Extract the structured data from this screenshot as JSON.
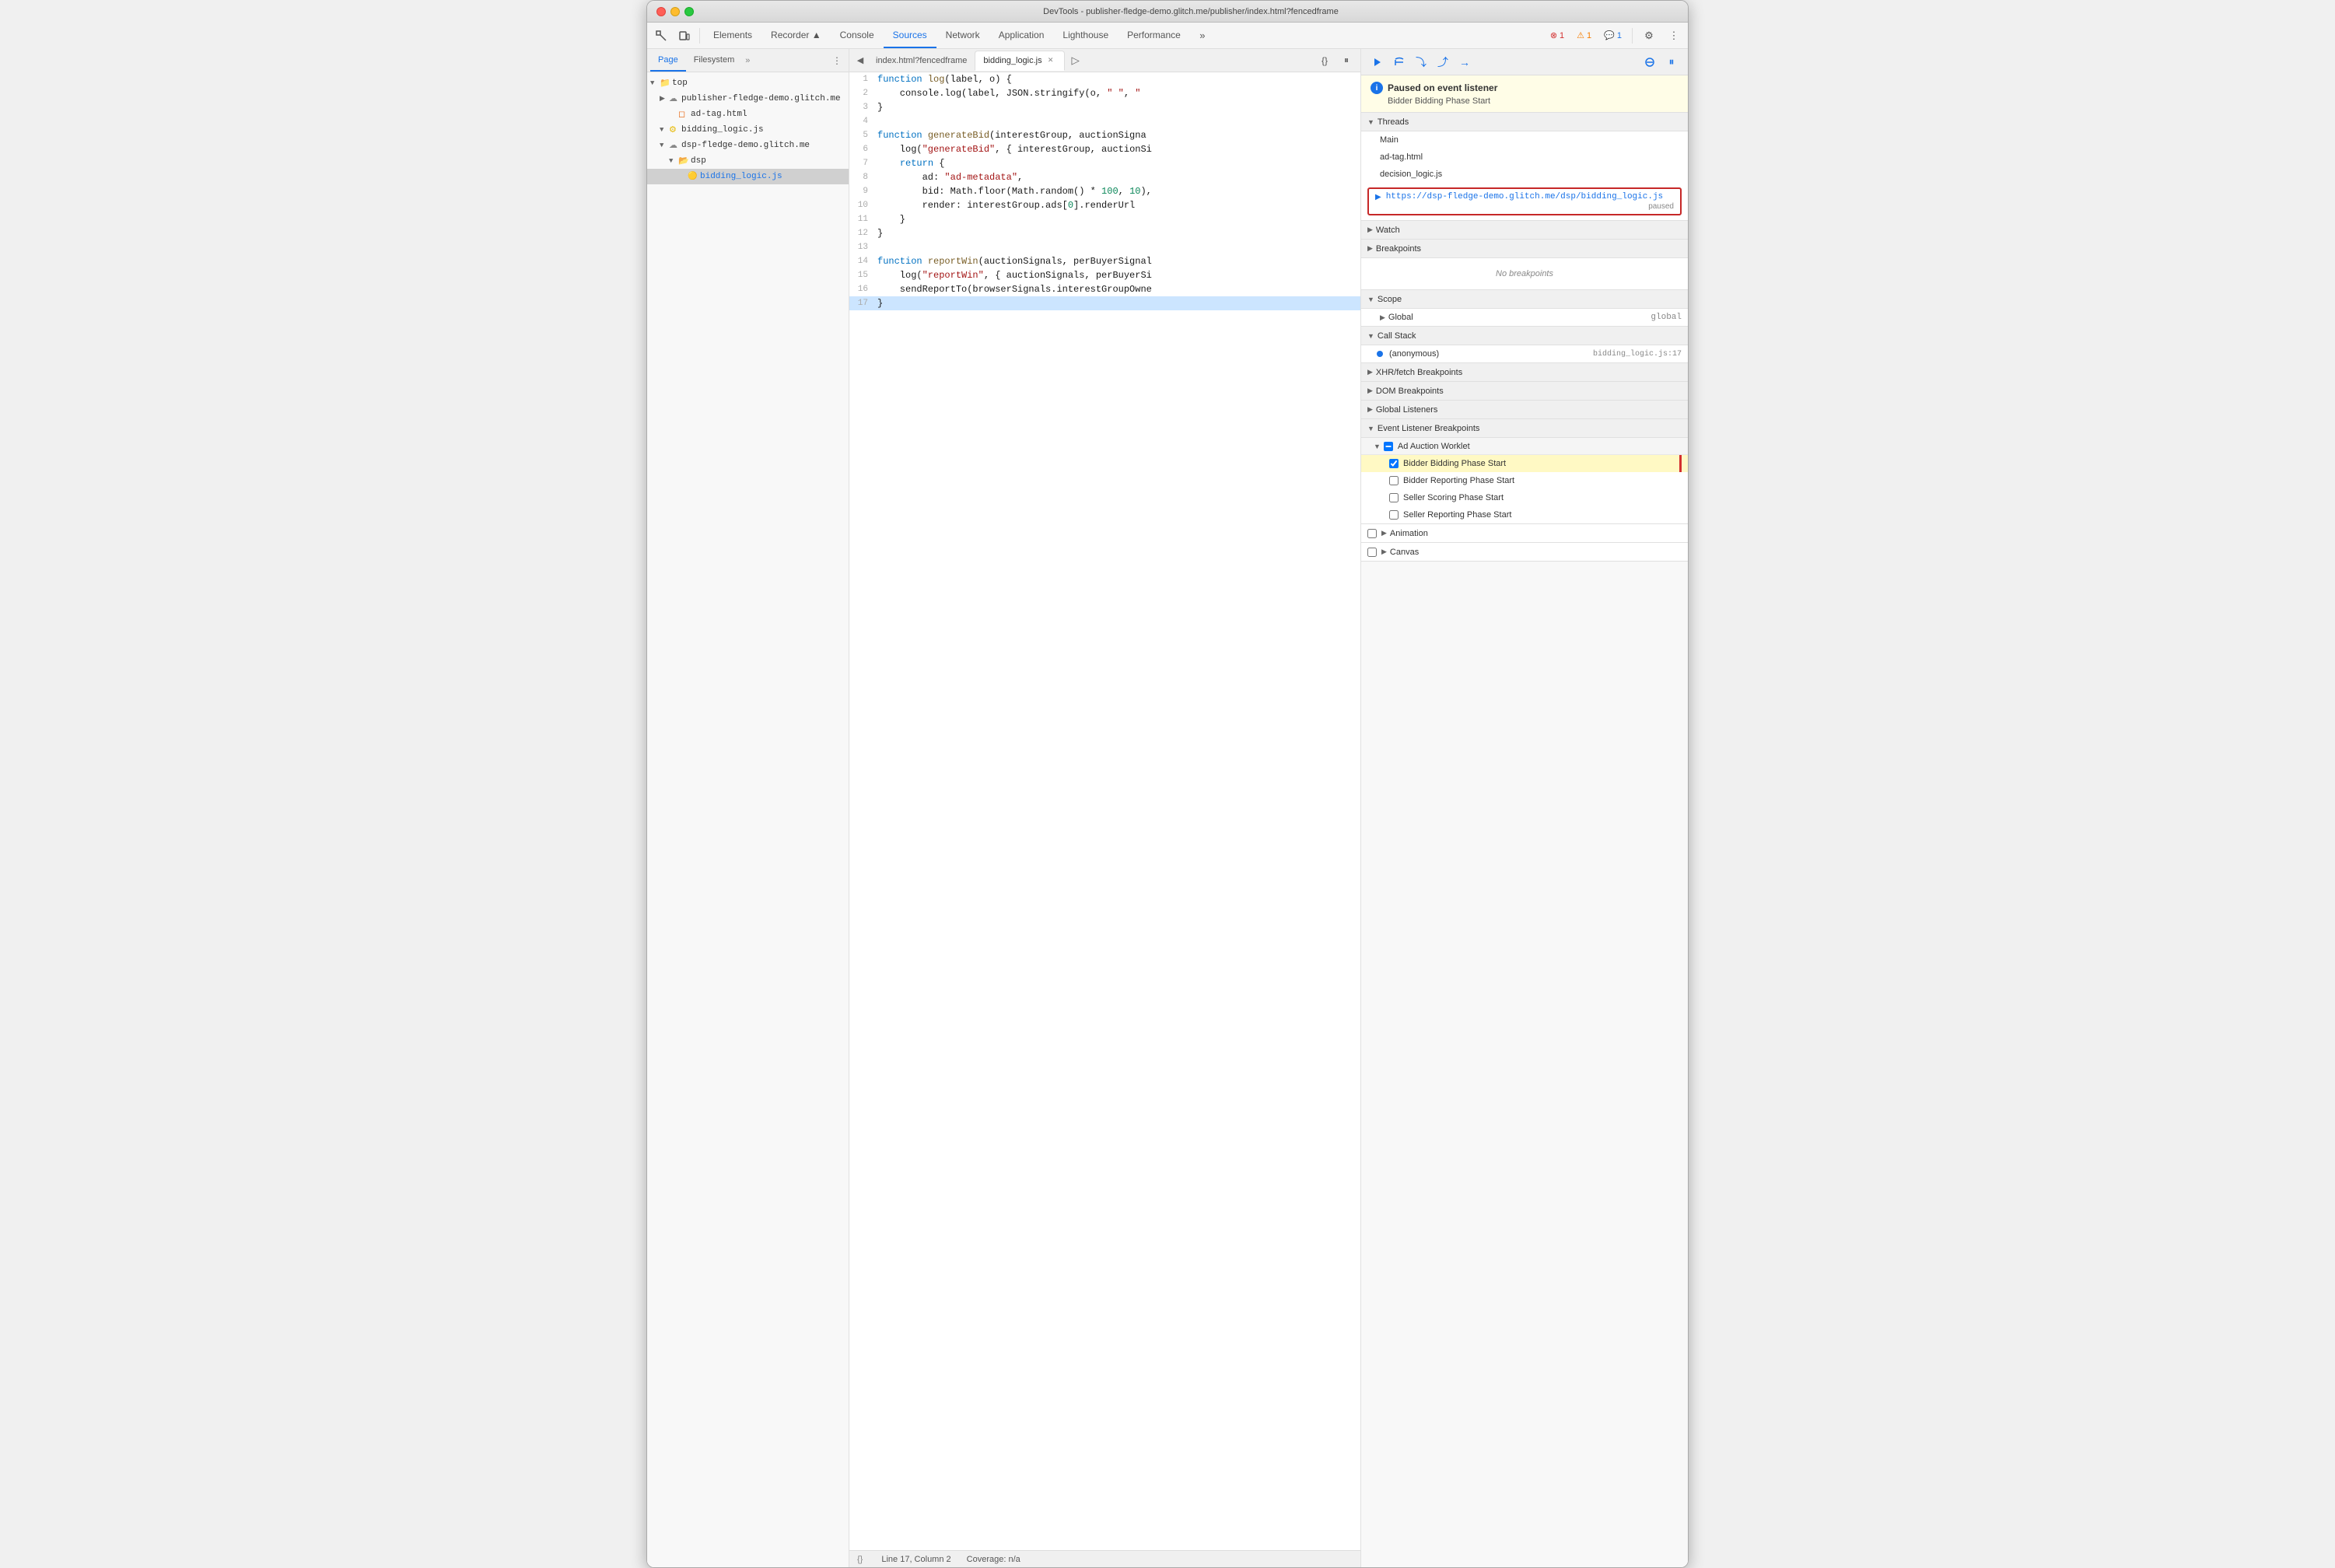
{
  "window": {
    "title": "DevTools - publisher-fledge-demo.glitch.me/publisher/index.html?fencedframe"
  },
  "toolbar": {
    "tabs": [
      {
        "id": "elements",
        "label": "Elements",
        "active": false
      },
      {
        "id": "recorder",
        "label": "Recorder ▲",
        "active": false
      },
      {
        "id": "console",
        "label": "Console",
        "active": false
      },
      {
        "id": "sources",
        "label": "Sources",
        "active": true
      },
      {
        "id": "network",
        "label": "Network",
        "active": false
      },
      {
        "id": "application",
        "label": "Application",
        "active": false
      },
      {
        "id": "lighthouse",
        "label": "Lighthouse",
        "active": false
      },
      {
        "id": "performance",
        "label": "Performance",
        "active": false
      }
    ],
    "badges": {
      "errors": "1",
      "warnings": "1",
      "messages": "1"
    }
  },
  "file_tree": {
    "panel_tabs": [
      "Page",
      "Filesystem"
    ],
    "items": [
      {
        "indent": 0,
        "arrow": "▼",
        "icon": "folder",
        "label": "top",
        "type": "folder"
      },
      {
        "indent": 1,
        "arrow": "▶",
        "icon": "cloud",
        "label": "publisher-fledge-demo.glitch.me",
        "type": "domain"
      },
      {
        "indent": 2,
        "arrow": "",
        "icon": "file-html",
        "label": "ad-tag.html",
        "type": "file"
      },
      {
        "indent": 1,
        "arrow": "▼",
        "icon": "file-js-gear",
        "label": "bidding_logic.js",
        "type": "file-active"
      },
      {
        "indent": 1,
        "arrow": "▼",
        "icon": "cloud",
        "label": "dsp-fledge-demo.glitch.me",
        "type": "domain"
      },
      {
        "indent": 2,
        "arrow": "▼",
        "icon": "folder",
        "label": "dsp",
        "type": "folder"
      },
      {
        "indent": 3,
        "arrow": "",
        "icon": "file-js",
        "label": "bidding_logic.js",
        "type": "file-selected"
      }
    ]
  },
  "editor": {
    "tabs": [
      {
        "id": "index",
        "label": "index.html?fencedframe",
        "active": false,
        "closeable": false
      },
      {
        "id": "bidding",
        "label": "bidding_logic.js",
        "active": true,
        "closeable": true
      }
    ],
    "lines": [
      {
        "num": 1,
        "code": "function log(label, o) {",
        "highlighted": false
      },
      {
        "num": 2,
        "code": "    console.log(label, JSON.stringify(o, \" \", \"",
        "highlighted": false
      },
      {
        "num": 3,
        "code": "}",
        "highlighted": false
      },
      {
        "num": 4,
        "code": "",
        "highlighted": false
      },
      {
        "num": 5,
        "code": "function generateBid(interestGroup, auctionSigna",
        "highlighted": false
      },
      {
        "num": 6,
        "code": "    log(\"generateBid\", { interestGroup, auctionSi",
        "highlighted": false
      },
      {
        "num": 7,
        "code": "    return {",
        "highlighted": false
      },
      {
        "num": 8,
        "code": "        ad: \"ad-metadata\",",
        "highlighted": false
      },
      {
        "num": 9,
        "code": "        bid: Math.floor(Math.random() * 100, 10),",
        "highlighted": false
      },
      {
        "num": 10,
        "code": "        render: interestGroup.ads[0].renderUrl",
        "highlighted": false
      },
      {
        "num": 11,
        "code": "    }",
        "highlighted": false
      },
      {
        "num": 12,
        "code": "}",
        "highlighted": false
      },
      {
        "num": 13,
        "code": "",
        "highlighted": false
      },
      {
        "num": 14,
        "code": "function reportWin(auctionSignals, perBuyerSignal",
        "highlighted": false
      },
      {
        "num": 15,
        "code": "    log(\"reportWin\", { auctionSignals, perBuyerSi",
        "highlighted": false
      },
      {
        "num": 16,
        "code": "    sendReportTo(browserSignals.interestGroupOwne",
        "highlighted": false
      },
      {
        "num": 17,
        "code": "}",
        "highlighted": true
      }
    ],
    "status": {
      "line": "Line 17, Column 2",
      "coverage": "Coverage: n/a"
    }
  },
  "debugger": {
    "toolbar_buttons": [
      "resume",
      "step-over",
      "step-into",
      "step-out",
      "step",
      "deactivate",
      "pause"
    ],
    "paused_notice": {
      "title": "Paused on event listener",
      "subtitle": "Bidder Bidding Phase Start"
    },
    "threads": {
      "label": "Threads",
      "items": [
        {
          "label": "Main",
          "paused": false
        },
        {
          "label": "ad-tag.html",
          "paused": false
        },
        {
          "label": "decision_logic.js",
          "paused": false
        }
      ],
      "highlighted": {
        "url": "https://dsp-fledge-demo.glitch.me/dsp/bidding_logic.js",
        "status": "paused"
      }
    },
    "watch": {
      "label": "Watch",
      "expanded": false
    },
    "breakpoints": {
      "label": "Breakpoints",
      "empty_message": "No breakpoints"
    },
    "scope": {
      "label": "Scope",
      "items": [
        {
          "label": "Global",
          "value": "global"
        }
      ]
    },
    "call_stack": {
      "label": "Call Stack",
      "items": [
        {
          "label": "(anonymous)",
          "location": "bidding_logic.js:17"
        }
      ]
    },
    "xhr_breakpoints": {
      "label": "XHR/fetch Breakpoints"
    },
    "dom_breakpoints": {
      "label": "DOM Breakpoints"
    },
    "global_listeners": {
      "label": "Global Listeners"
    },
    "event_listener_breakpoints": {
      "label": "Event Listener Breakpoints",
      "groups": [
        {
          "label": "Ad Auction Worklet",
          "expanded": true,
          "items": [
            {
              "label": "Bidder Bidding Phase Start",
              "checked": true,
              "highlighted": true
            },
            {
              "label": "Bidder Reporting Phase Start",
              "checked": false
            },
            {
              "label": "Seller Scoring Phase Start",
              "checked": false
            },
            {
              "label": "Seller Reporting Phase Start",
              "checked": false
            }
          ]
        },
        {
          "label": "Animation",
          "expanded": false
        },
        {
          "label": "Canvas",
          "expanded": false
        }
      ]
    }
  }
}
